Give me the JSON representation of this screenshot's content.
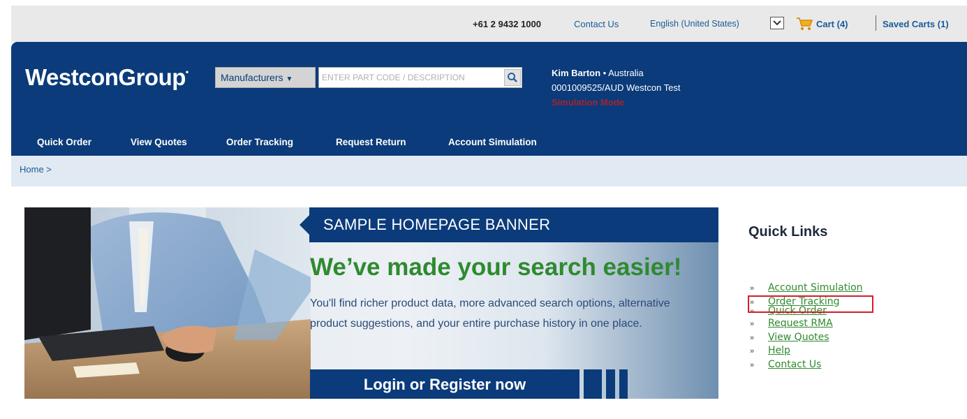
{
  "topbar": {
    "phone": "+61 2 9432 1000",
    "contact": "Contact Us",
    "language": "English (United States)",
    "cart": "Cart (4)",
    "saved_carts": "Saved Carts (1)"
  },
  "header": {
    "logo": "WestconGroup",
    "manufacturers_label": "Manufacturers",
    "search_placeholder": "ENTER PART CODE / DESCRIPTION",
    "user_name": "Kim Barton",
    "user_country": "Australia",
    "account": "0001009525/AUD  Westcon Test",
    "simulation_mode": "Simulation Mode"
  },
  "nav": {
    "items": [
      "Quick Order",
      "View Quotes",
      "Order Tracking",
      "Request Return",
      "Account Simulation"
    ]
  },
  "breadcrumb": "Home >",
  "banner": {
    "tag": "SAMPLE HOMEPAGE BANNER",
    "headline": "We’ve made your search easier!",
    "body": "You'll find richer product data, more advanced search options, alternative product suggestions, and your entire purchase history in one place.",
    "cta": "Login or Register now"
  },
  "quick_links": {
    "title": "Quick Links",
    "items": [
      "Account Simulation",
      "Order Tracking",
      "Quick Order",
      "Request RMA",
      "View Quotes",
      "Help",
      "Contact Us"
    ]
  },
  "colors": {
    "brand_blue": "#0b3b7a",
    "link_green": "#2f8a2f",
    "highlight_red": "#d21f2a",
    "simulation_red": "#d11c1c"
  }
}
